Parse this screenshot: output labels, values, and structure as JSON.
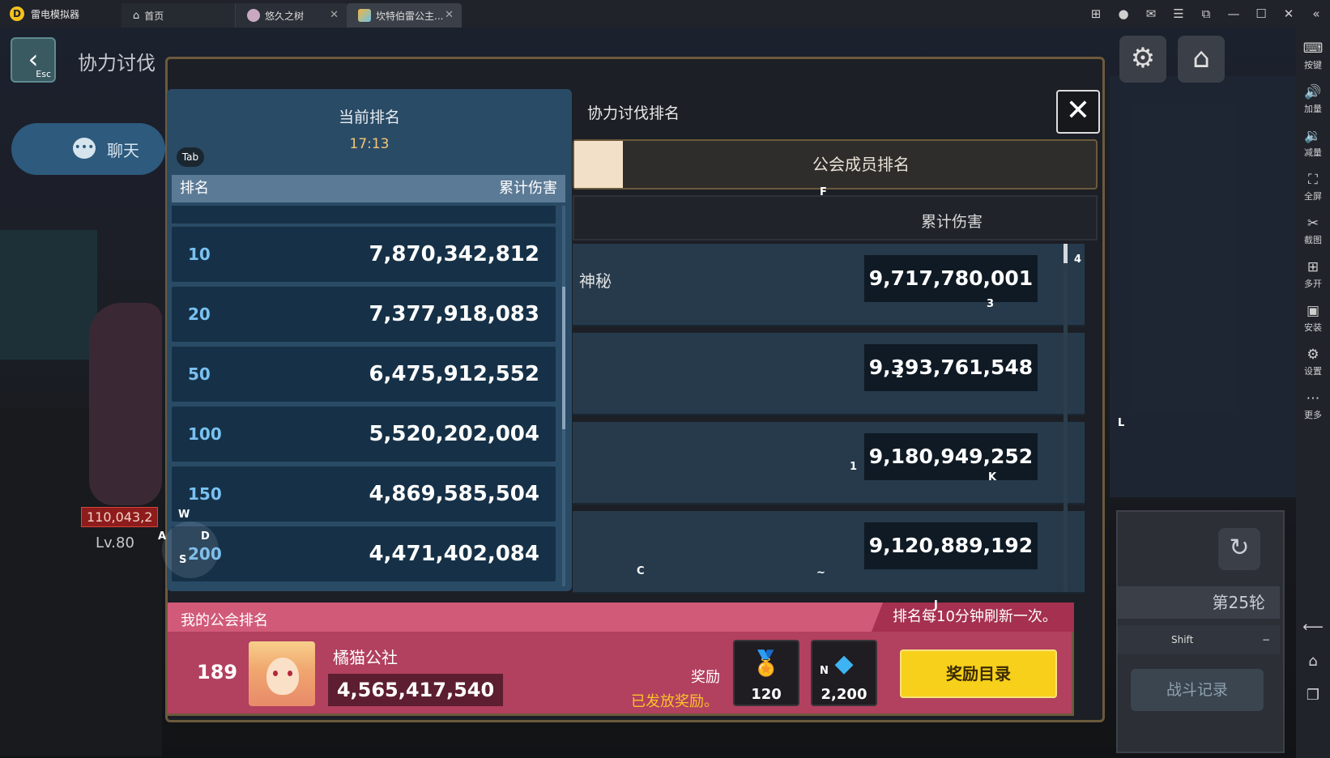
{
  "titlebar": {
    "app_name": "雷电模拟器",
    "tabs": [
      {
        "label": "首页"
      },
      {
        "label": "悠久之树"
      },
      {
        "label": "坎特伯雷公主..."
      }
    ]
  },
  "sidebar": {
    "items": [
      {
        "label": "按键",
        "icon": "keyboard-icon"
      },
      {
        "label": "加量",
        "icon": "volume-up-icon"
      },
      {
        "label": "减量",
        "icon": "volume-down-icon"
      },
      {
        "label": "全屏",
        "icon": "fullscreen-icon"
      },
      {
        "label": "截图",
        "icon": "scissors-icon"
      },
      {
        "label": "多开",
        "icon": "multi-instance-icon"
      },
      {
        "label": "安装",
        "icon": "apk-icon"
      },
      {
        "label": "设置",
        "icon": "gear-icon"
      },
      {
        "label": "更多",
        "icon": "more-icon"
      }
    ]
  },
  "game_bg": {
    "esc_label": "Esc",
    "title": "协力讨伐",
    "chat_label": "聊天",
    "hp_value": "110,043,2",
    "level": "Lv.80",
    "round_label": "第25轮",
    "shift_key": "Shift",
    "shift_mark": "−",
    "battle_log_label": "战斗记录"
  },
  "dialog": {
    "title": "协力讨伐排名",
    "tab_guild_members": "公会成员排名",
    "col_damage": "累计伤害",
    "members": [
      {
        "name": "神秘",
        "damage": "9,717,780,001"
      },
      {
        "name": "",
        "damage": "9,393,761,548"
      },
      {
        "name": "",
        "damage": "9,180,949,252"
      },
      {
        "name": "",
        "damage": "9,120,889,192"
      }
    ]
  },
  "current_ranking": {
    "title": "当前排名",
    "time": "17:13",
    "tab_key": "Tab",
    "col_rank": "排名",
    "col_damage": "累计伤害",
    "rows": [
      {
        "rank": "10",
        "damage": "7,870,342,812"
      },
      {
        "rank": "20",
        "damage": "7,377,918,083"
      },
      {
        "rank": "50",
        "damage": "6,475,912,552"
      },
      {
        "rank": "100",
        "damage": "5,520,202,004"
      },
      {
        "rank": "150",
        "damage": "4,869,585,504"
      },
      {
        "rank": "200",
        "damage": "4,471,402,084"
      }
    ]
  },
  "my_guild": {
    "title": "我的公会排名",
    "refresh_note": "排名每10分钟刷新一次。",
    "rank": "189",
    "name": "橘猫公社",
    "damage": "4,565,417,540",
    "reward_label": "奖励",
    "reward_status": "已发放奖励。",
    "rewards": [
      {
        "icon": "medal-icon",
        "qty": "120"
      },
      {
        "icon": "gem-icon",
        "qty": "2,200"
      }
    ],
    "reward_list_button": "奖励目录"
  },
  "key_hints": {
    "w": "W",
    "a": "A",
    "s": "S",
    "d": "D",
    "f": "F",
    "c": "C",
    "j": "J",
    "k": "K",
    "l": "L",
    "n": "N",
    "tilde": "~",
    "k1": "1",
    "k2": "2",
    "k3": "3",
    "k4": "4"
  }
}
